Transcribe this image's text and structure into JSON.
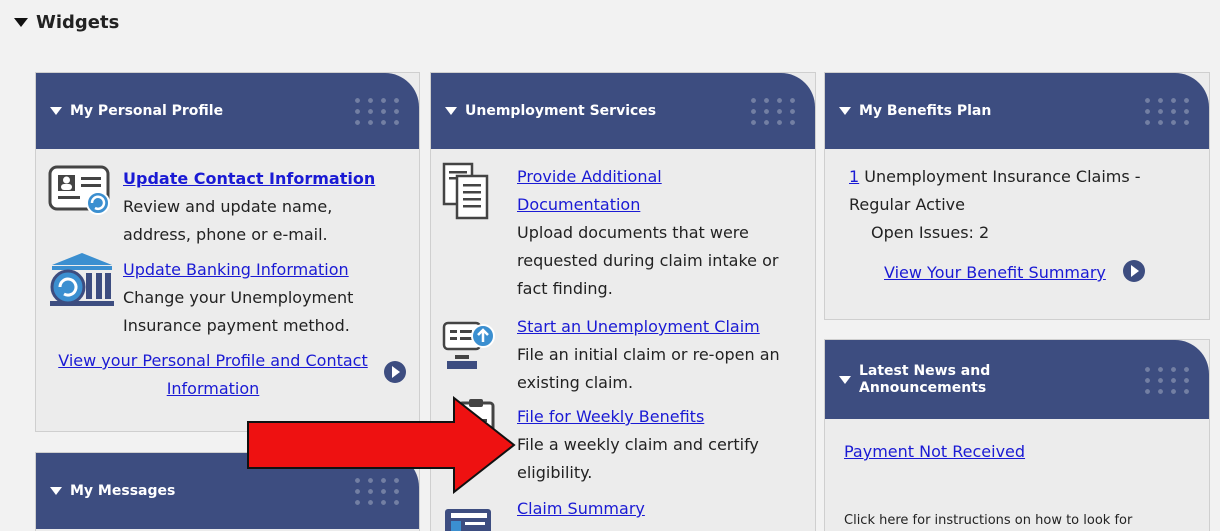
{
  "section": {
    "title": "Widgets"
  },
  "profile": {
    "title": "My Personal Profile",
    "update_contact": {
      "link": "Update Contact Information",
      "desc": [
        "Review and update name,",
        "address, phone or e-mail."
      ]
    },
    "update_banking": {
      "link": "Update Banking Information",
      "desc": [
        "Change your Unemployment",
        "Insurance payment method."
      ]
    },
    "view_profile_link": [
      "View your Personal Profile and Contact",
      "Information"
    ]
  },
  "messages": {
    "title": "My Messages"
  },
  "services": {
    "title": "Unemployment Services",
    "provide_docs": {
      "link": [
        "Provide Additional",
        "Documentation"
      ],
      "desc": [
        "Upload documents that were",
        "requested during claim intake or",
        "fact finding."
      ]
    },
    "start_claim": {
      "link": "Start an Unemployment Claim",
      "desc": [
        "File an initial claim or re-open an",
        "existing claim."
      ]
    },
    "weekly": {
      "link": "File for Weekly Benefits",
      "desc": [
        "File a weekly claim and certify",
        "eligibility."
      ]
    },
    "summary": {
      "link": "Claim Summary"
    }
  },
  "benefits": {
    "title": "My Benefits Plan",
    "count": "1",
    "claims_text": " Unemployment Insurance Claims -",
    "claims_text2": "Regular Active",
    "open_issues": "Open Issues: 2",
    "view_summary": "View Your Benefit Summary"
  },
  "news": {
    "title": [
      "Latest News and",
      "Announcements"
    ],
    "item_link": "Payment Not Received",
    "item_text": "Click here for instructions on how to look for"
  },
  "colors": {
    "header": "#3d4d80",
    "link": "#1a1ad4",
    "arrow": "#ee1111"
  }
}
